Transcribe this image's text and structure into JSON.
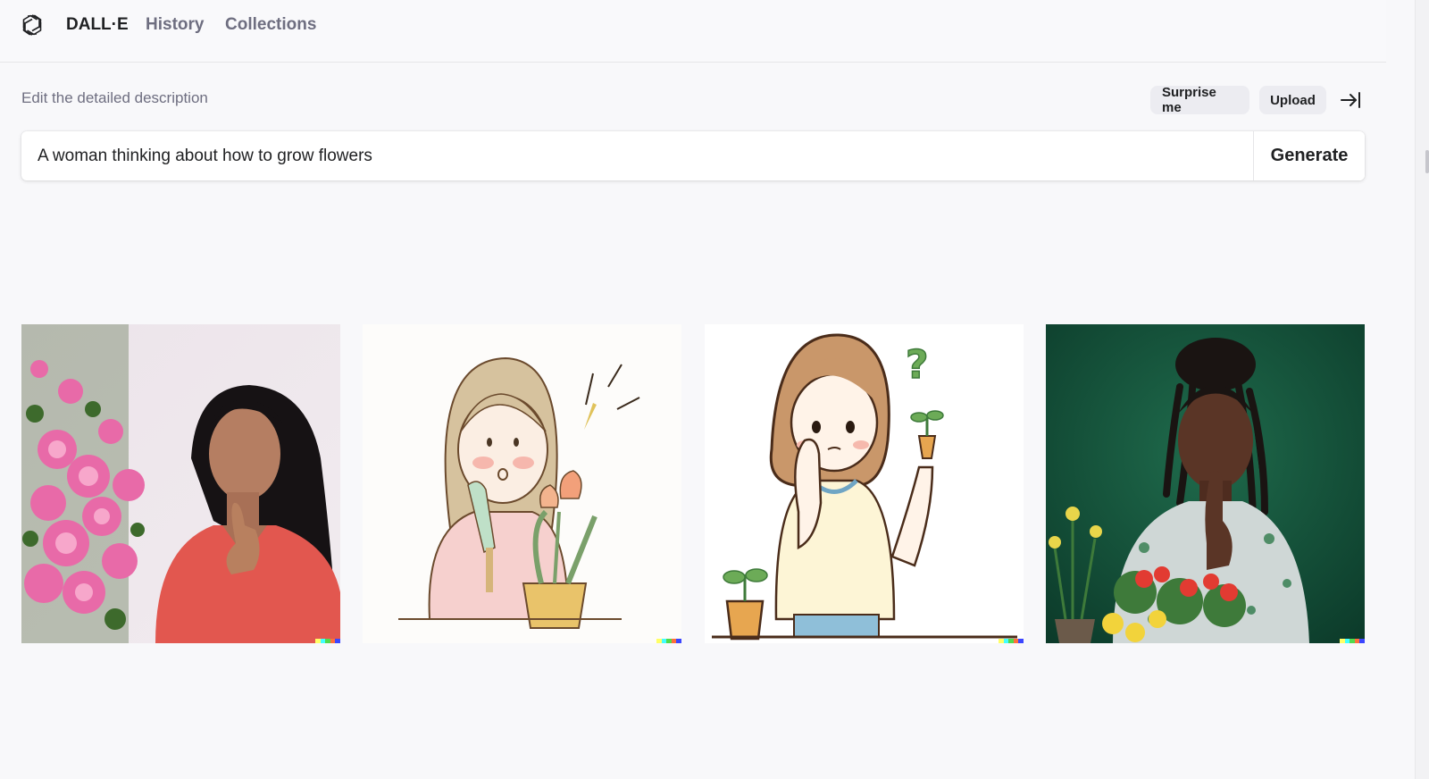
{
  "nav": {
    "brand": "DALL·E",
    "history": "History",
    "collections": "Collections"
  },
  "prompt": {
    "label": "Edit the detailed description",
    "value": "A woman thinking about how to grow flowers",
    "surprise_label": "Surprise me",
    "upload_label": "Upload",
    "generate_label": "Generate"
  },
  "results": {
    "images": [
      {
        "style": "photo",
        "subject": "woman thinking beside pink flowers"
      },
      {
        "style": "watercolor illustration",
        "subject": "girl with potted tulips"
      },
      {
        "style": "line illustration",
        "subject": "girl thinking holding a seedling"
      },
      {
        "style": "photo",
        "subject": "woman thinking over potted flowers"
      }
    ],
    "watermark_colors": [
      "#ffff66",
      "#42ffff",
      "#51da4c",
      "#ff6e3c",
      "#3c46ff"
    ]
  },
  "icons": {
    "logo": "openai-logo-icon",
    "collapse": "collapse-right-icon"
  }
}
